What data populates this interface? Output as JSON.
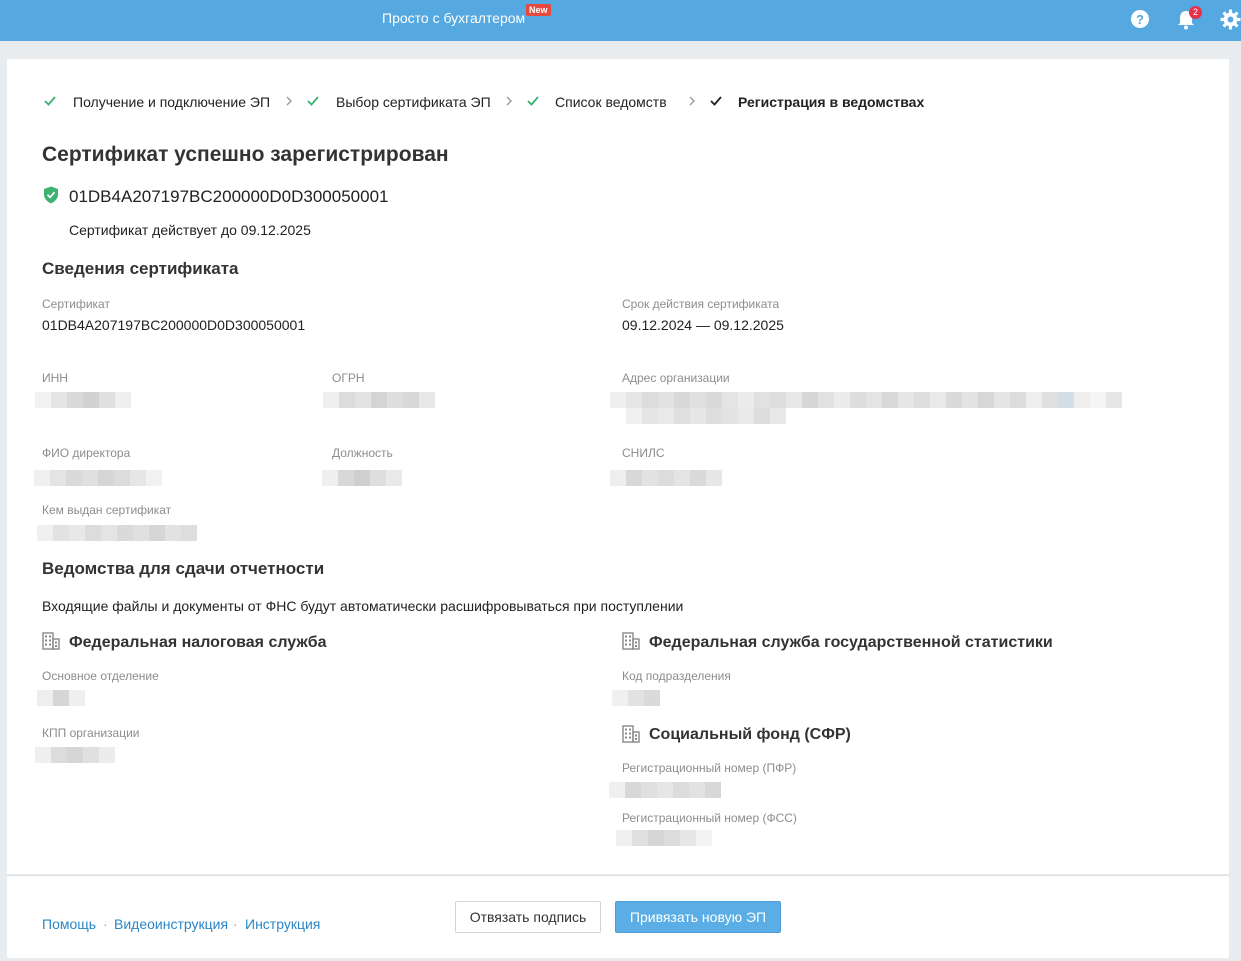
{
  "header": {
    "brand": "Просто с бухгалтером",
    "new_badge": "New",
    "notifications_count": "2",
    "help_icon": "help-icon",
    "bell_icon": "bell-icon",
    "settings_icon": "gear-icon",
    "bg_color": "#55a8e0"
  },
  "steps": [
    {
      "label": "Получение и подключение ЭП",
      "state": "done"
    },
    {
      "label": "Выбор сертификата ЭП",
      "state": "done"
    },
    {
      "label": "Список ведомств",
      "state": "done"
    },
    {
      "label": "Регистрация в ведомствах",
      "state": "current"
    }
  ],
  "status": {
    "title": "Сертификат успешно зарегистрирован",
    "cert_number": "01DB4A207197BC200000D0D300050001",
    "valid_until": "Сертификат действует до 09.12.2025",
    "accent": "#3cb371"
  },
  "details": {
    "title": "Сведения сертификата",
    "cert_label": "Сертификат",
    "cert_value": "01DB4A207197BC200000D0D300050001",
    "validity_label": "Срок действия сертификата",
    "validity_value": "09.12.2024 — 09.12.2025",
    "inn_label": "ИНН",
    "ogrn_label": "ОГРН",
    "address_label": "Адрес организации",
    "director_label": "ФИО директора",
    "position_label": "Должность",
    "snils_label": "СНИЛС",
    "issuer_label": "Кем выдан сертификат"
  },
  "agencies": {
    "title": "Ведомства для сдачи отчетности",
    "note": "Входящие файлы и документы от ФНС будут автоматически расшифровываться при поступлении",
    "fns": {
      "name": "Федеральная налоговая служба",
      "main_branch_label": "Основное отделение",
      "kpp_label": "КПП организации"
    },
    "rosstat": {
      "name": "Федеральная служба государственной статистики",
      "code_label": "Код подразделения"
    },
    "sfr": {
      "name": "Социальный фонд (СФР)",
      "pfr_label": "Регистрационный номер (ПФР)",
      "fss_label": "Регистрационный номер (ФСС)"
    }
  },
  "footer": {
    "links": [
      "Помощь",
      "Видеоинструкция",
      "Инструкция"
    ],
    "unbind_button": "Отвязать подпись",
    "bind_button": "Привязать новую ЭП",
    "link_color": "#2b86c6",
    "primary_color": "#5aaee5"
  }
}
